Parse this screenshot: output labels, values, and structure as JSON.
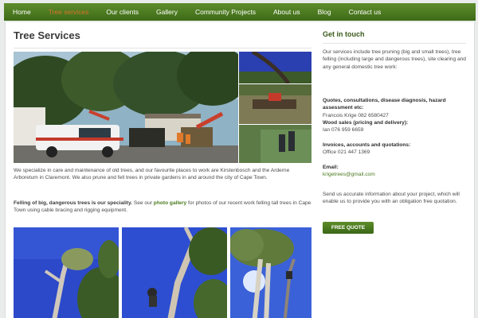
{
  "nav": {
    "items": [
      {
        "label": "Home"
      },
      {
        "label": "Tree services"
      },
      {
        "label": "Our clients"
      },
      {
        "label": "Gallery"
      },
      {
        "label": "Community Projects"
      },
      {
        "label": "About us"
      },
      {
        "label": "Blog"
      },
      {
        "label": "Contact us"
      }
    ],
    "active_index": 1,
    "active_color": "#d9722a",
    "bar_color": "#4a7a1f"
  },
  "main": {
    "title": "Tree Services",
    "para1": "We specialize in care and maintenance of old trees, and our favourite places to work are Kirstenbosch and the Arderne Arboretum in Claremont. We also prune and fell trees in private gardens in and around the city of Cape Town.",
    "para2": {
      "bold": "Felling of big, dangerous trees is our speciality.",
      "before_link": "See our",
      "link": "photo gallery",
      "after_link": "for photos of our recent work felling tall trees in Cape Town using cable bracing and rigging equipment."
    }
  },
  "sidebar": {
    "title": "Get in touch",
    "intro": "Our services include tree pruning (big and small trees), tree felling (including large and dangerous trees), site clearing and any general domestic tree work:",
    "contacts": [
      {
        "heading": "Quotes, consultations, disease diagnosis, hazard assessment etc:",
        "value": "Francois Krige 082 6580427"
      },
      {
        "heading": "Wood sales (pricing and delivery):",
        "value": "Ian 076 959 6659"
      },
      {
        "heading": "Invoices, accounts and quotations:",
        "value": "Office 021 447 1369"
      },
      {
        "heading": "Email:",
        "value": "krigetrees@gmail.com"
      }
    ],
    "note": "Send us accurate information about your project, which will enable us to provide you with an obligation free quotation.",
    "button_label": "FREE QUOTE"
  }
}
